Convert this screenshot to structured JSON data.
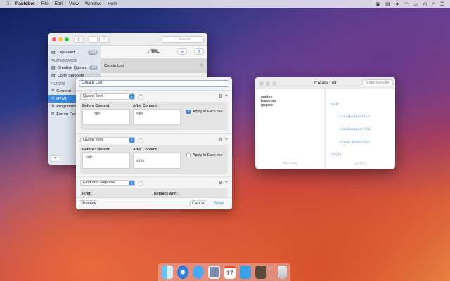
{
  "menubar": {
    "app": "Pastebot",
    "items": [
      "File",
      "Edit",
      "View",
      "Window",
      "Help"
    ],
    "status_icons": [
      "calendar-icon",
      "notes-icon",
      "dropbox-icon",
      "wifi-icon",
      "battery-icon",
      "clock-icon",
      "search-icon",
      "list-icon"
    ]
  },
  "main_window": {
    "search_placeholder": "Search",
    "list_title": "HTML",
    "list_row": "Create List",
    "sidebar": {
      "clipboard": {
        "label": "Clipboard",
        "badge": "134"
      },
      "pasteboards_header": "PASTEBOARDS",
      "pasteboards": [
        {
          "label": "Creative Quotes",
          "badge": "14"
        },
        {
          "label": "Code Snippets"
        }
      ],
      "filters_header": "FILTERS",
      "filters": [
        {
          "label": "General"
        },
        {
          "label": "HTML",
          "selected": true
        },
        {
          "label": "Programming"
        },
        {
          "label": "Forum Code"
        }
      ],
      "add": "+"
    }
  },
  "editor": {
    "name": "Create List",
    "steps": [
      {
        "type": "Quote Text",
        "before_label": "Before Content:",
        "before": "<li>",
        "after_label": "After Content:",
        "after": "</li>",
        "apply_label": "Apply to Each line",
        "apply": true
      },
      {
        "type": "Quote Text",
        "before_label": "Before Content:",
        "before": "<ul>",
        "after_label": "After Content:",
        "after": "</ul>",
        "apply_label": "Apply to Each line",
        "apply": false
      },
      {
        "type": "Find and Replace",
        "find_label": "Find:",
        "replace_label": "Replace with:"
      }
    ],
    "help": "?",
    "preview": "Preview",
    "cancel": "Cancel",
    "save": "Save"
  },
  "preview_window": {
    "title": "Create List",
    "copy": "Copy Results",
    "before_lines": [
      "apples",
      "bananas",
      "grapes"
    ],
    "after_lines": [
      "<ul>",
      "    <li>apples</li>",
      "    <li>bananas</li>",
      "    <li>grapes</li>",
      "</ul>"
    ],
    "before_label": "BEFORE",
    "after_label": "AFTER"
  },
  "dock": {
    "apps": [
      "Finder",
      "Safari",
      "Messages",
      "Preview",
      "Calendar",
      "Tweetbot",
      "Pastebot",
      "Trash"
    ],
    "calendar_day": "17"
  },
  "colors": {
    "accent": "#3a8ae0"
  }
}
